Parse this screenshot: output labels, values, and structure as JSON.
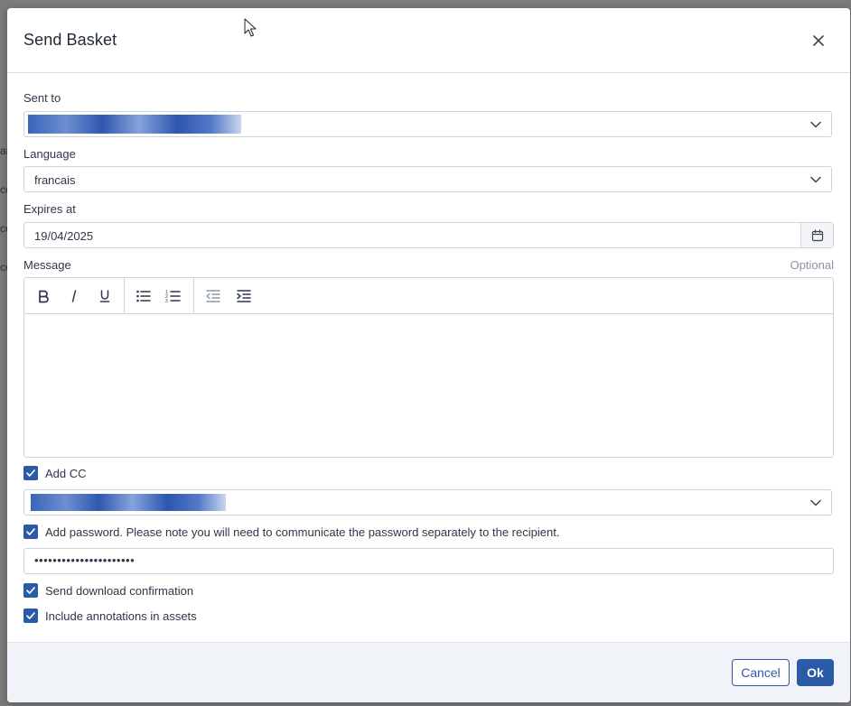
{
  "dialog": {
    "title": "Send Basket"
  },
  "background": {
    "fragments": [
      "ar",
      "ce",
      "ce",
      "ce"
    ]
  },
  "fields": {
    "sent_to": {
      "label": "Sent to",
      "value": ""
    },
    "language": {
      "label": "Language",
      "value": "francais"
    },
    "expires_at": {
      "label": "Expires at",
      "value": "19/04/2025"
    },
    "message": {
      "label": "Message",
      "optional_label": "Optional",
      "value": ""
    }
  },
  "editor_toolbar": {
    "buttons": [
      "bold-icon",
      "italic-icon",
      "underline-icon",
      "bulleted-list-icon",
      "numbered-list-icon",
      "outdent-icon",
      "indent-icon"
    ]
  },
  "options": {
    "add_cc": {
      "label": "Add CC",
      "checked": true,
      "value": ""
    },
    "add_password": {
      "label": "Add password. Please note you will need to communicate the password separately to the recipient.",
      "checked": true,
      "value": "••••••••••••••••••••••"
    },
    "download_confirmation": {
      "label": "Send download confirmation",
      "checked": true
    },
    "include_annotations": {
      "label": "Include annotations in assets",
      "checked": true
    }
  },
  "footer": {
    "cancel_label": "Cancel",
    "ok_label": "Ok"
  },
  "colors": {
    "accent": "#2b5aa6",
    "footer_bg": "#f0f3f8",
    "border": "#cfd4dc"
  }
}
